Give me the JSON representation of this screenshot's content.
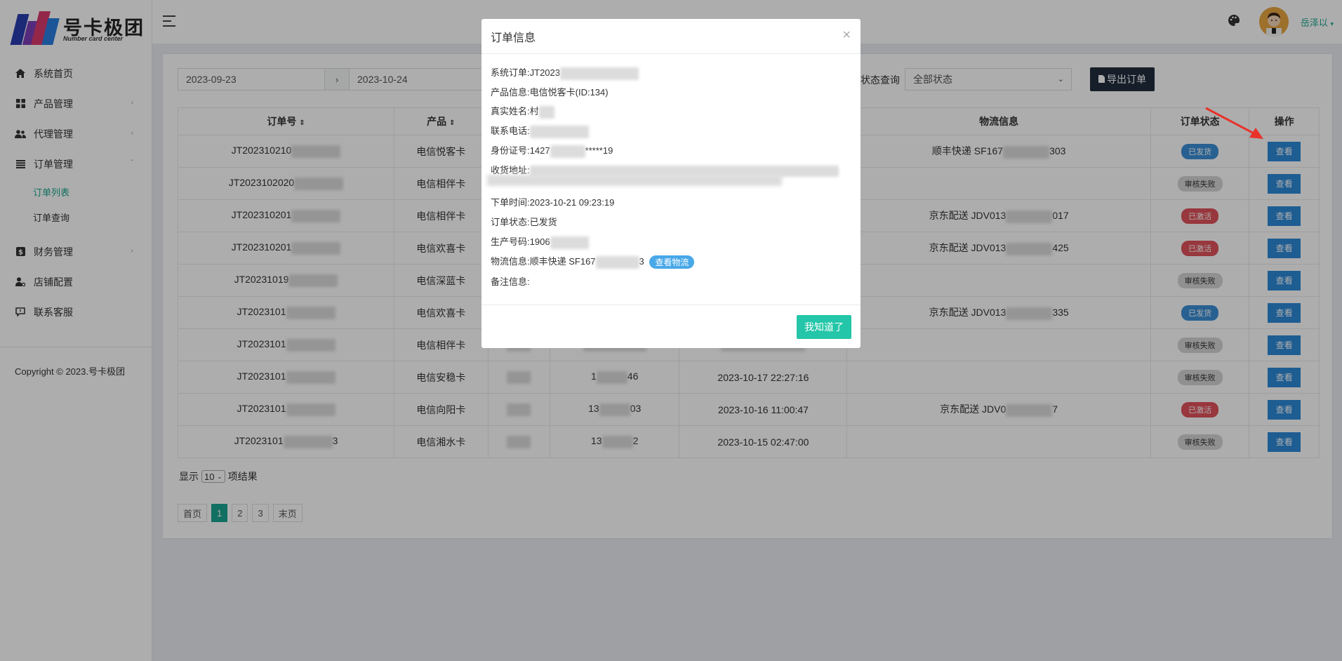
{
  "brand": {
    "title": "号卡极团",
    "subtitle": "Number card center"
  },
  "sidebar": {
    "items": [
      {
        "label": "系统首页",
        "icon": "home-icon"
      },
      {
        "label": "产品管理",
        "icon": "grid-icon"
      },
      {
        "label": "代理管理",
        "icon": "users-icon"
      },
      {
        "label": "订单管理",
        "icon": "list-icon"
      },
      {
        "label": "财务管理",
        "icon": "dollar-icon"
      },
      {
        "label": "店铺配置",
        "icon": "user-gear-icon"
      },
      {
        "label": "联系客服",
        "icon": "chat-icon"
      }
    ],
    "sub_items": [
      "订单列表",
      "订单查询"
    ],
    "copyright": "Copyright © 2023.号卡极团"
  },
  "topbar": {
    "user": "岳泽以"
  },
  "filters": {
    "start_date": "2023-09-23",
    "sep": "›",
    "end_date": "2023-10-24",
    "status_label": "状态查询",
    "status_value": "全部状态",
    "export_label": "导出订单"
  },
  "table": {
    "headers": {
      "order_no": "订单号",
      "product": "产品",
      "logistics": "物流信息",
      "status": "订单状态",
      "action": "操作"
    },
    "rows": [
      {
        "order": "JT202310210",
        "product": "电信悦客卡",
        "logistics": "顺丰快递 SF167",
        "logi_tail": "303",
        "status": "已发货",
        "kind": "sent"
      },
      {
        "order": "JT2023102020",
        "product": "电信相伴卡",
        "logistics": "",
        "logi_tail": "",
        "status": "审核失败",
        "kind": "fail"
      },
      {
        "order": "JT202310201",
        "product": "电信相伴卡",
        "logistics": "京东配送 JDV013",
        "logi_tail": "017",
        "status": "已激活",
        "kind": "act"
      },
      {
        "order": "JT202310201",
        "product": "电信欢喜卡",
        "logistics": "京东配送 JDV013",
        "logi_tail": "425",
        "status": "已激活",
        "kind": "act"
      },
      {
        "order": "JT20231019",
        "product": "电信深蓝卡",
        "logistics": "",
        "logi_tail": "",
        "status": "审核失败",
        "kind": "fail"
      },
      {
        "order": "JT2023101",
        "product": "电信欢喜卡",
        "logistics": "京东配送 JDV013",
        "logi_tail": "335",
        "status": "已发货",
        "kind": "sent"
      },
      {
        "order": "JT2023101",
        "product": "电信相伴卡",
        "logistics": "",
        "logi_tail": "",
        "status": "审核失败",
        "kind": "fail"
      },
      {
        "order": "JT2023101",
        "product": "电信安稳卡",
        "phone_head": "1",
        "phone_tail": "46",
        "time": "2023-10-17 22:27:16",
        "logistics": "",
        "logi_tail": "",
        "status": "审核失败",
        "kind": "fail"
      },
      {
        "order": "JT2023101",
        "product": "电信向阳卡",
        "phone_head": "13",
        "phone_tail": "03",
        "time": "2023-10-16 11:00:47",
        "logistics": "京东配送 JDV0",
        "logi_tail": "7",
        "status": "已激活",
        "kind": "act"
      },
      {
        "order": "JT2023101",
        "order_tail": "3",
        "product": "电信湘水卡",
        "phone_head": "13",
        "phone_tail": "2",
        "time": "2023-10-15 02:47:00",
        "logistics": "",
        "logi_tail": "",
        "status": "审核失败",
        "kind": "fail"
      }
    ],
    "view_label": "查看"
  },
  "pager": {
    "show": "显示",
    "per_page": "10",
    "suffix": "项结果",
    "first": "首页",
    "p1": "1",
    "p2": "2",
    "p3": "3",
    "last": "末页"
  },
  "modal": {
    "title": "订单信息",
    "close": "×",
    "system_order_k": "系统订单:",
    "system_order_v": "JT2023",
    "product_k": "产品信息:",
    "product_v": "电信悦客卡(ID:134)",
    "name_k": "真实姓名:",
    "name_v": "村",
    "phone_k": "联系电话:",
    "id_k": "身份证号:",
    "id_v": "1427",
    "id_tail": "*****19",
    "address_k": "收货地址:",
    "order_time_k": "下单时间:",
    "order_time_v": "2023-10-21 09:23:19",
    "order_status_k": "订单状态:",
    "order_status_v": "已发货",
    "prod_no_k": "生产号码:",
    "prod_no_v": "1906",
    "logistics_k": "物流信息:",
    "logistics_v": "顺丰快递 SF167",
    "logistics_tail": "3",
    "view_logistics": "查看物流",
    "remark_k": "备注信息:",
    "ok": "我知道了"
  },
  "colors": {
    "accent": "#1aa68f",
    "primary": "#2d8ad8",
    "danger": "#e0515a",
    "ok_button": "#23c6a8"
  }
}
